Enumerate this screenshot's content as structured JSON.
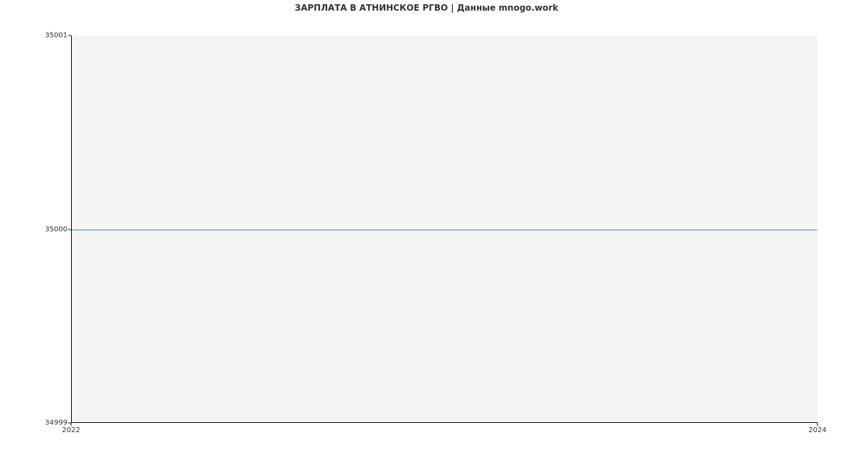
{
  "chart_data": {
    "type": "line",
    "title": "ЗАРПЛАТА В АТНИНСКОЕ РГВО | Данные mnogo.work",
    "xlabel": "",
    "ylabel": "",
    "x": [
      2022,
      2024
    ],
    "values": [
      35000,
      35000
    ],
    "xlim": [
      2022,
      2024
    ],
    "ylim": [
      34999,
      35001
    ],
    "y_ticks": [
      34999,
      35000,
      35001
    ],
    "x_ticks": [
      2022,
      2024
    ],
    "y_tick_labels": [
      "34999",
      "35000",
      "35001"
    ],
    "x_tick_labels": [
      "2022",
      "2024"
    ],
    "line_color": "#4a7ec9",
    "grid": false
  }
}
